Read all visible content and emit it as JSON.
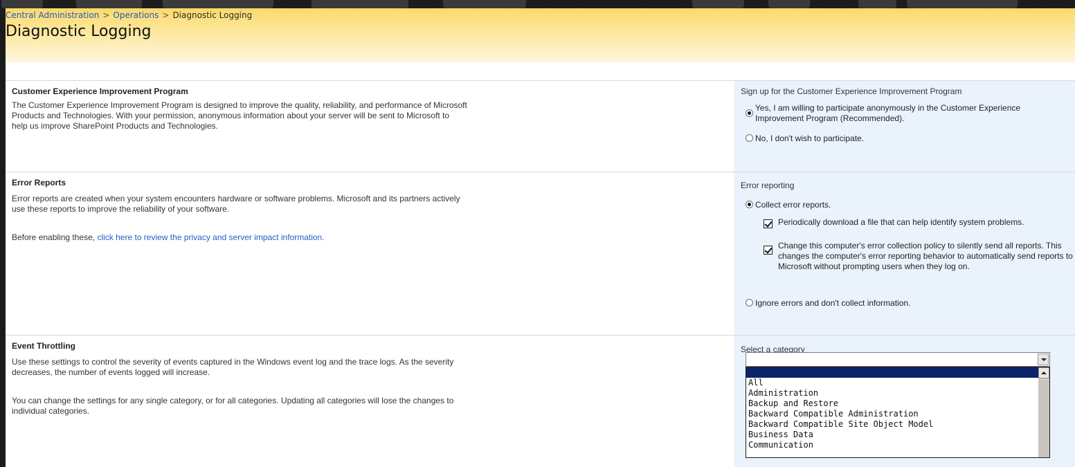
{
  "breadcrumb": {
    "items": [
      "Central Administration",
      "Operations",
      "Diagnostic Logging"
    ],
    "separator": ">"
  },
  "page": {
    "title": "Diagnostic Logging"
  },
  "ceip": {
    "title": "Customer Experience Improvement Program",
    "description": "The Customer Experience Improvement Program is designed to improve the quality, reliability, and performance of Microsoft Products and Technologies. With your permission, anonymous information about your server will be sent to Microsoft to help us improve SharePoint Products and Technologies.",
    "control_label": "Sign up for the Customer Experience Improvement Program",
    "option_yes": "Yes, I am willing to participate anonymously in the Customer Experience Improvement Program (Recommended).",
    "option_no": "No, I don't wish to participate.",
    "selected": "yes"
  },
  "error_reports": {
    "title": "Error Reports",
    "description": "Error reports are created when your system encounters hardware or software problems. Microsoft and its partners actively use these reports to improve the reliability of your software.",
    "privacy_prefix": "Before enabling these,",
    "privacy_link": "click here to review the privacy and server impact information.",
    "control_label": "Error reporting",
    "option_collect": "Collect error reports.",
    "check_download": "Periodically download a file that can help identify system problems.",
    "check_policy": "Change this computer's error collection policy to silently send all reports. This changes the computer's error reporting behavior to automatically send reports to Microsoft without prompting users when they log on.",
    "option_ignore": "Ignore errors and don't collect information.",
    "selected": "collect",
    "check_download_checked": true,
    "check_policy_checked": true
  },
  "event_throttling": {
    "title": "Event Throttling",
    "description1": "Use these settings to control the severity of events captured in the Windows event log and the trace logs. As the severity decreases, the number of events logged will increase.",
    "description2": "You can change the settings for any single category, or for all categories. Updating all categories will lose the changes to individual categories.",
    "control_label": "Select a category",
    "category_value": "",
    "category_options": [
      "",
      "All",
      "Administration",
      "Backup and Restore",
      "Backward Compatible Administration",
      "Backward Compatible Site Object Model",
      "Business Data",
      "Communication"
    ],
    "highlighted_index": 0
  },
  "colors": {
    "link": "#1c5bbd",
    "header_top": "#fbd96b",
    "panel": "#eaf3fc",
    "selected_item": "#0a246a"
  }
}
